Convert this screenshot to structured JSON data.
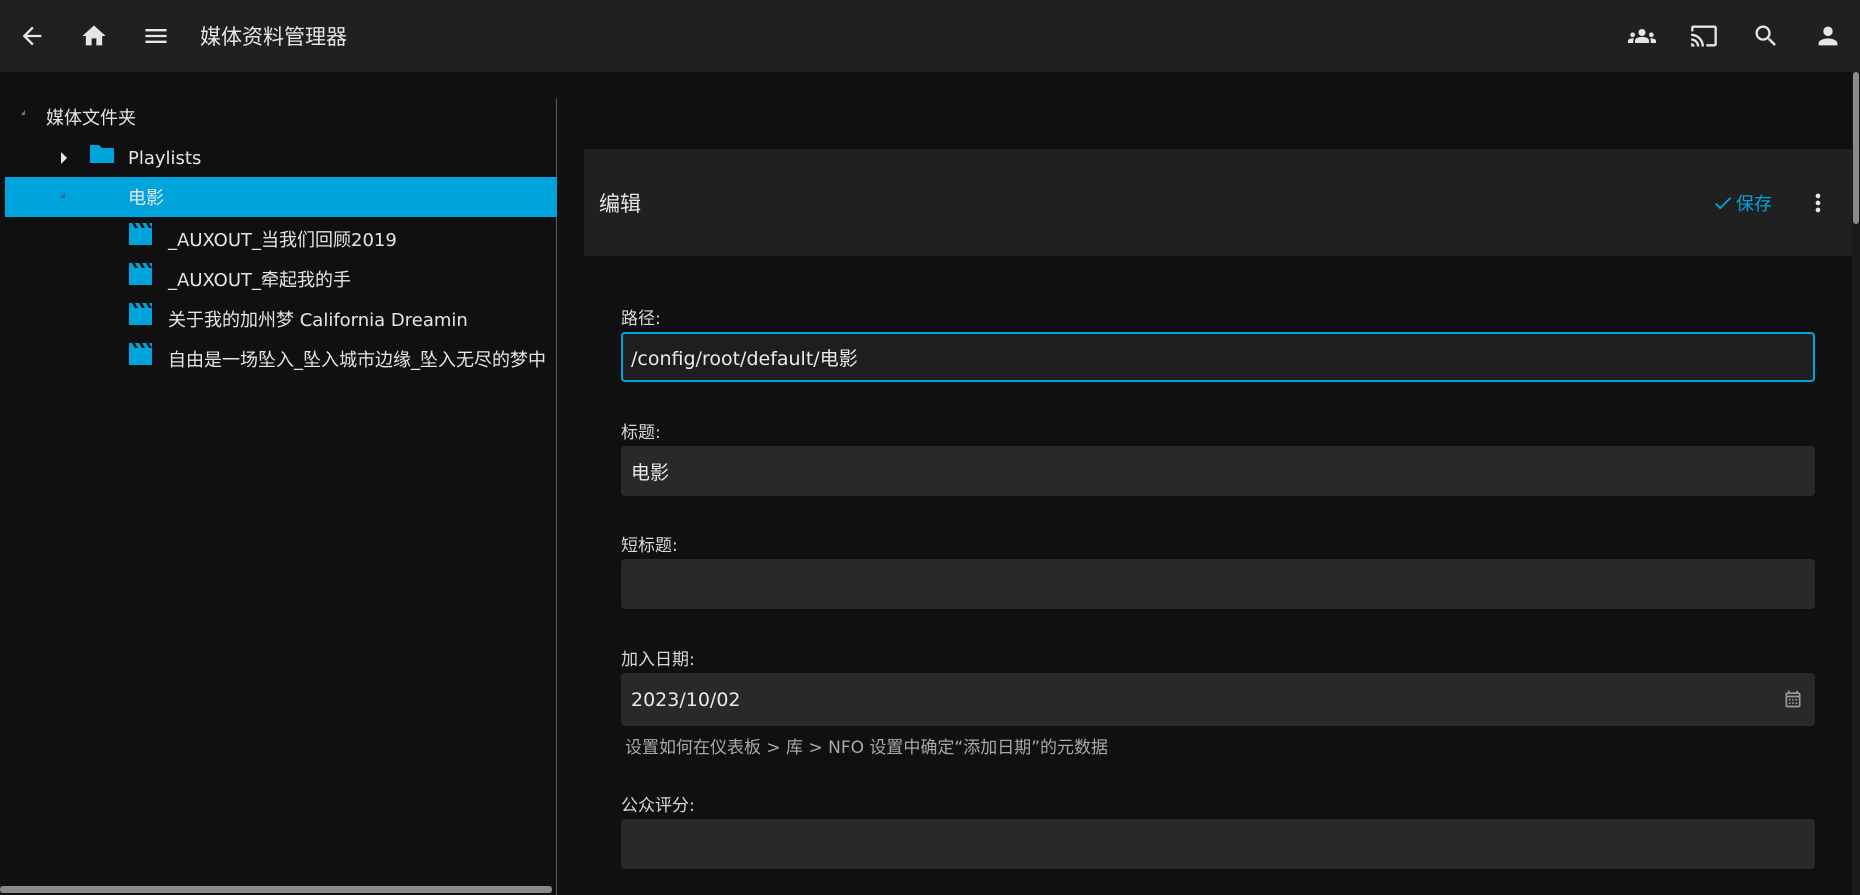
{
  "header": {
    "title": "媒体资料管理器",
    "icons": [
      "back-arrow-icon",
      "home-icon",
      "menu-icon",
      "users-icon",
      "cast-icon",
      "search-icon",
      "user-icon"
    ]
  },
  "tree": {
    "root": "媒体文件夹",
    "items": [
      {
        "label": "Playlists",
        "icon": "folder-icon",
        "expanded": false
      },
      {
        "label": "电影",
        "icon": "folder-icon",
        "expanded": true,
        "selected": true
      },
      {
        "label": "_AUXOUT_当我们回顾2019",
        "icon": "clapperboard-icon"
      },
      {
        "label": "_AUXOUT_牵起我的手",
        "icon": "clapperboard-icon"
      },
      {
        "label": "关于我的加州梦 California Dreamin",
        "icon": "clapperboard-icon"
      },
      {
        "label": "自由是一场坠入_坠入城市边缘_坠入无尽的梦中",
        "icon": "clapperboard-icon"
      }
    ]
  },
  "editor": {
    "title": "编辑",
    "save_label": "保存"
  },
  "form": {
    "path": {
      "label": "路径:",
      "value": "/config/root/default/电影"
    },
    "title": {
      "label": "标题:",
      "value": "电影"
    },
    "short_title": {
      "label": "短标题:",
      "value": ""
    },
    "date_added": {
      "label": "加入日期:",
      "value": "2023/10/02",
      "help": "设置如何在仪表板 > 库 > NFO 设置中确定“添加日期”的元数据"
    },
    "community_rating": {
      "label": "公众评分:",
      "value": ""
    }
  },
  "colors": {
    "accent": "#00a4dc",
    "header_bg": "#202020",
    "page_bg": "#101010",
    "input_bg": "#292929"
  }
}
